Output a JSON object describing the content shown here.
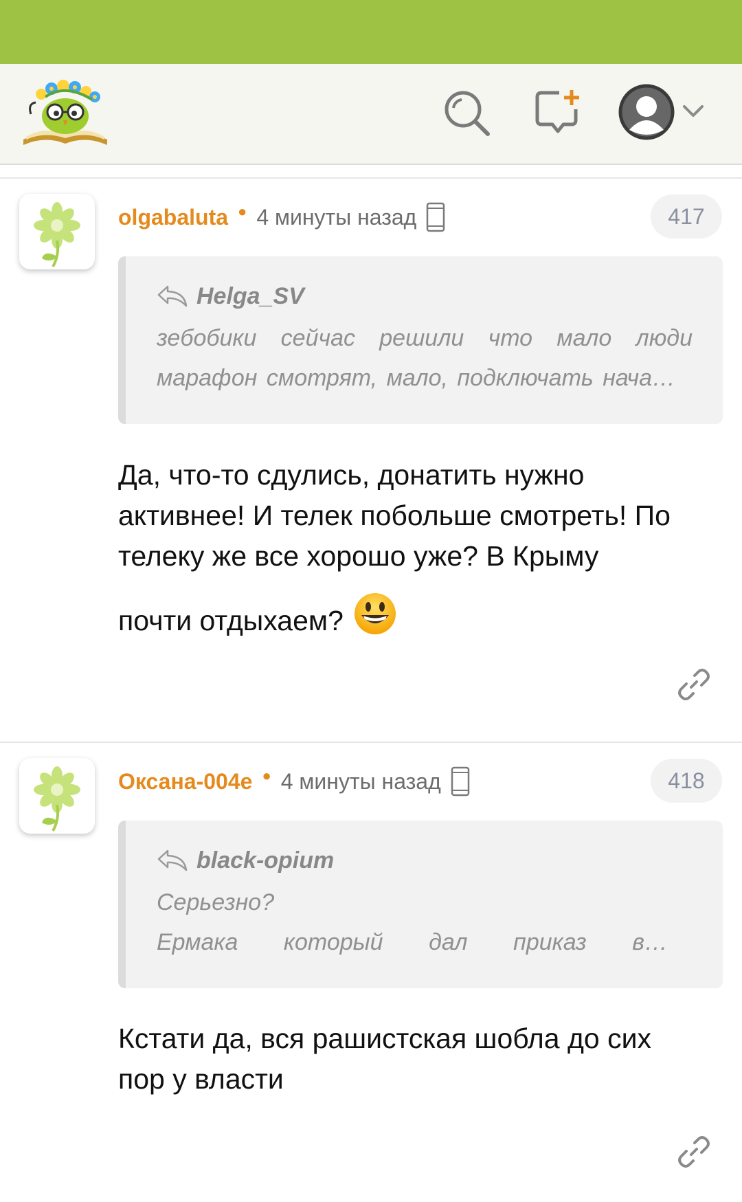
{
  "icons": {
    "logo": "logo-owl-book",
    "search": "search-icon",
    "new_message": "new-message-icon",
    "avatar": "user-avatar-icon",
    "chevron": "chevron-down-icon",
    "device": "mobile-phone-icon",
    "reply": "reply-icon",
    "link": "link-icon",
    "emoji": "grinning-face-emoji"
  },
  "colors": {
    "top_bar": "#9dc244",
    "header_bg": "#f6f6f0",
    "author": "#e58a1d",
    "quote_bg": "#f2f2f2"
  },
  "comments": [
    {
      "author": "olgabaluta",
      "time": "4 минуты назад",
      "number": "417",
      "quote_author": "Helga_SV",
      "quote_line1": "зебобики сейчас решили что мало люди",
      "quote_line1_words": [
        "зебобики",
        "сейчас",
        "решили",
        "что",
        "мало",
        "люди"
      ],
      "quote_line2": "марафон смотрят, мало, подключать нача…",
      "body_lines": [
        "Да, что-то сдулись, донатить нужно",
        "активнее! И телек побольше смотреть! По",
        "телеку же все хорошо уже? В Крыму",
        "почти отдыхаем?"
      ]
    },
    {
      "author": "Оксана-004е",
      "time": "4 минуты назад",
      "number": "418",
      "quote_author": "black-opium",
      "quote_line1": "Серьезно?",
      "quote_line2": "Ермака который дал приказ в…",
      "quote_line2_words": [
        "Ермака",
        "который",
        "дал",
        "приказ",
        "в…"
      ],
      "body_lines": [
        "Кстати да, вся рашистская шобла до сих",
        "пор у власти"
      ]
    }
  ]
}
